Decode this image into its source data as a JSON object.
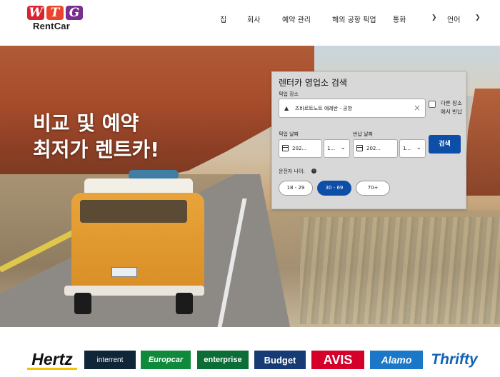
{
  "logo": {
    "letters": [
      "W",
      "T",
      "G"
    ],
    "brand": "RentCar"
  },
  "nav": {
    "items": [
      "집",
      "회사",
      "예약 관리",
      "해외 공항 픽업"
    ],
    "currency": "통화",
    "language": "언어"
  },
  "hero": {
    "title_line1": "비교 및 예약",
    "title_line2": "최저가 렌트카!"
  },
  "search": {
    "title": "렌터카 영업소 검색",
    "pickup_location_label": "픽업 장소",
    "pickup_location_value": "즈바르트노트 예레반 - 공항",
    "different_return_label": "다른 장소에서 반납",
    "pickup_date_label": "픽업 날짜",
    "pickup_date_value": "202...",
    "pickup_time_value": "1...",
    "return_date_label": "반납 날짜",
    "return_date_value": "202...",
    "return_time_value": "1...",
    "search_button": "검색",
    "driver_age_label": "운전자 나이:",
    "age_options": [
      "18 - 29",
      "30 - 69",
      "70+"
    ],
    "selected_age": "30 - 69"
  },
  "brands": [
    "Hertz",
    "interrent",
    "Europcar",
    "enterprise",
    "Budget",
    "AVIS",
    "Alamo",
    "Thrifty"
  ],
  "colors": {
    "primary": "#0d4fa8",
    "panel": "#d8d8d8"
  }
}
